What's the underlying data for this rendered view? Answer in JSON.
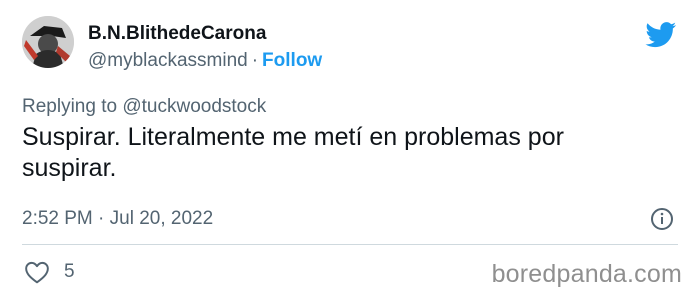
{
  "tweet": {
    "author": {
      "display_name": "B.N.BlithedeCarona",
      "handle": "@myblackassmind",
      "separator": "·",
      "follow_label": "Follow"
    },
    "replying_to": {
      "prefix": "Replying to",
      "mention": "@tuckwoodstock"
    },
    "text": "Suspirar. Literalmente me metí en problemas por suspirar.",
    "timestamp": "2:52 PM · Jul 20, 2022",
    "likes": "5"
  },
  "watermark": "boredpanda.com",
  "icons": {
    "brand": "twitter-bird-icon",
    "info": "info-icon",
    "like": "heart-icon"
  },
  "colors": {
    "accent": "#1d9bf0",
    "secondary_text": "#536471",
    "primary_text": "#0f1419",
    "divider": "#cfd9de",
    "watermark": "#8f8f8f"
  }
}
